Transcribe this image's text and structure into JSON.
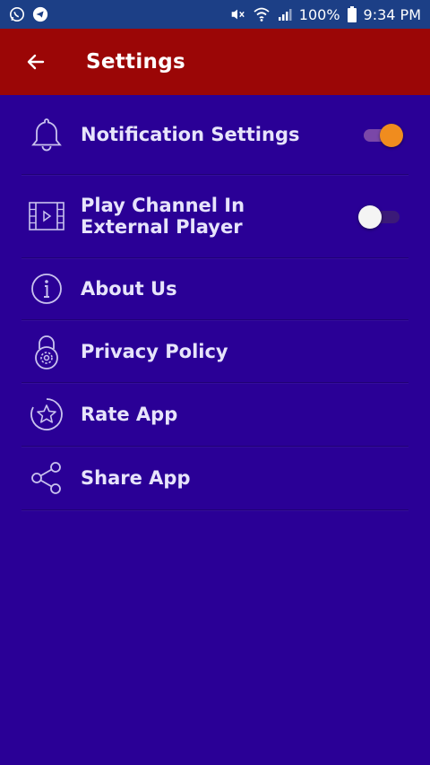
{
  "status_bar": {
    "battery": "100%",
    "time": "9:34 PM",
    "icons": [
      "whatsapp-icon",
      "telegram-icon",
      "mute-icon",
      "wifi-icon",
      "signal-icon",
      "battery-icon"
    ]
  },
  "app_bar": {
    "title": "Settings",
    "back_icon": "arrow-left-icon"
  },
  "settings": [
    {
      "label": "Notification Settings",
      "icon": "bell-icon",
      "toggle": true,
      "toggle_on": true
    },
    {
      "label": "Play Channel In External Player",
      "icon": "video-icon",
      "toggle": true,
      "toggle_on": false
    },
    {
      "label": "About Us",
      "icon": "info-icon"
    },
    {
      "label": "Privacy Policy",
      "icon": "privacy-icon"
    },
    {
      "label": "Rate App",
      "icon": "star-icon"
    },
    {
      "label": "Share App",
      "icon": "share-icon"
    }
  ],
  "colors": {
    "status_bar": "#1c3f86",
    "app_bar": "#9b0606",
    "background": "#2a0096",
    "toggle_on": "#f08c1e",
    "toggle_on_track": "#7a47a8",
    "toggle_off_knob": "#f4f4f4",
    "toggle_off_track": "#3b1a78"
  }
}
